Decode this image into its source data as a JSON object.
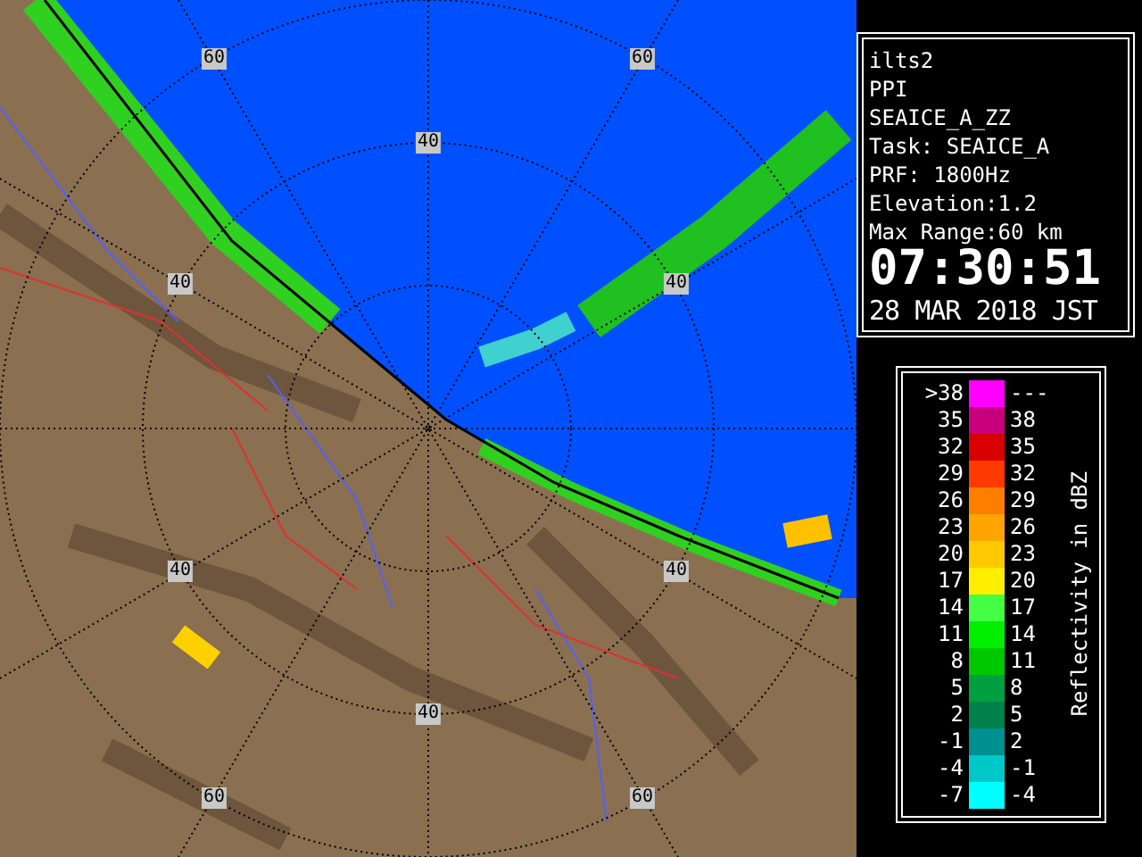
{
  "radar_map": {
    "range_labels": [
      {
        "text": "60"
      },
      {
        "text": "60"
      },
      {
        "text": "40"
      },
      {
        "text": "40"
      },
      {
        "text": "40"
      },
      {
        "text": "40"
      },
      {
        "text": "40"
      },
      {
        "text": "40"
      },
      {
        "text": "60"
      },
      {
        "text": "60"
      }
    ]
  },
  "info_panel": {
    "lines": [
      "ilts2",
      "PPI",
      "SEAICE_A_ZZ",
      "Task: SEAICE_A",
      "PRF: 1800Hz",
      "Elevation:1.2",
      "Max Range:60 km"
    ],
    "time": "07:30:51",
    "date": "28 MAR 2018 JST"
  },
  "legend": {
    "title": "Reflectivity in dBZ",
    "rows": [
      {
        "low": ">38",
        "high": "---",
        "color": "#ff00ff"
      },
      {
        "low": "35",
        "high": "38",
        "color": "#c8007c"
      },
      {
        "low": "32",
        "high": "35",
        "color": "#d80000"
      },
      {
        "low": "29",
        "high": "32",
        "color": "#ff3a00"
      },
      {
        "low": "26",
        "high": "29",
        "color": "#ff7e00"
      },
      {
        "low": "23",
        "high": "26",
        "color": "#ffa400"
      },
      {
        "low": "20",
        "high": "23",
        "color": "#ffc800"
      },
      {
        "low": "17",
        "high": "20",
        "color": "#ffee00"
      },
      {
        "low": "14",
        "high": "17",
        "color": "#44ff44"
      },
      {
        "low": "11",
        "high": "14",
        "color": "#00f000"
      },
      {
        "low": "8",
        "high": "11",
        "color": "#00c800"
      },
      {
        "low": "5",
        "high": "8",
        "color": "#00a040"
      },
      {
        "low": "2",
        "high": "5",
        "color": "#00804a"
      },
      {
        "low": "-1",
        "high": "2",
        "color": "#009090"
      },
      {
        "low": "-4",
        "high": "-1",
        "color": "#00c8c8"
      },
      {
        "low": "-7",
        "high": "-4",
        "color": "#00ffff"
      }
    ]
  }
}
